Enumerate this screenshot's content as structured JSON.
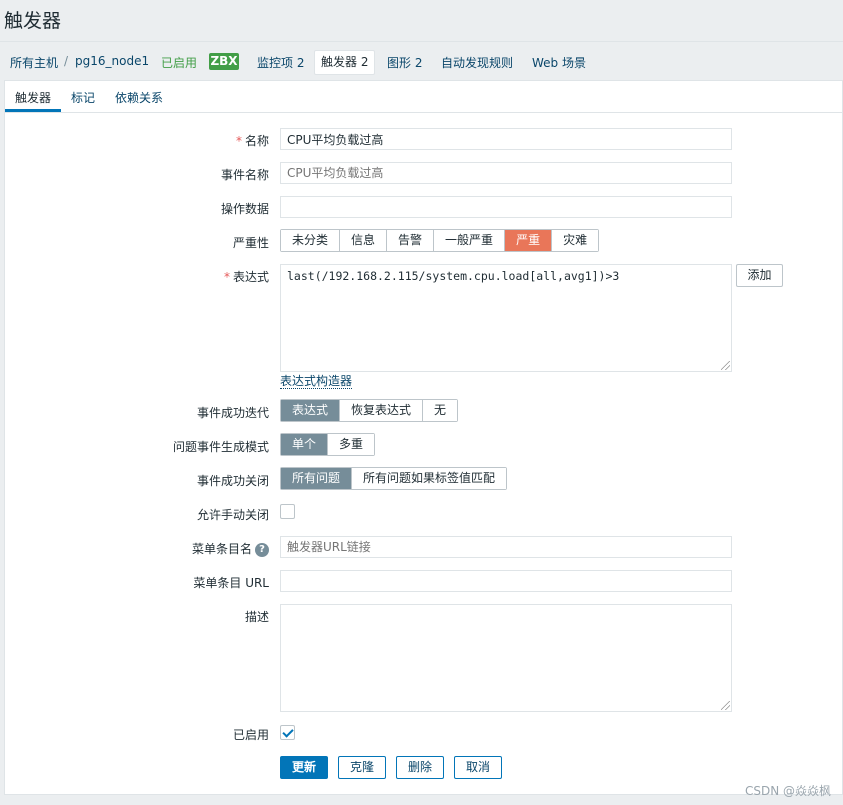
{
  "page_title": "触发器",
  "breadcrumb": {
    "all_hosts": "所有主机",
    "separator": "/",
    "host": "pg16_node1",
    "status": "已启用",
    "zbx_badge": "ZBX",
    "items": "监控项 2",
    "triggers": "触发器 2",
    "graphs": "图形 2",
    "discovery": "自动发现规则",
    "web": "Web 场景"
  },
  "tabs": [
    "触发器",
    "标记",
    "依赖关系"
  ],
  "form": {
    "name_label": "名称",
    "name_value": "CPU平均负载过高",
    "event_name_label": "事件名称",
    "event_name_placeholder": "CPU平均负载过高",
    "opdata_label": "操作数据",
    "opdata_value": "",
    "severity_label": "严重性",
    "severity_options": [
      "未分类",
      "信息",
      "告警",
      "一般严重",
      "严重",
      "灾难"
    ],
    "severity_selected": "严重",
    "expression_label": "表达式",
    "expression_value": "last(/192.168.2.115/system.cpu.load[all,avg1])>3",
    "add_button": "添加",
    "expression_builder": "表达式构造器",
    "ok_event_gen_label": "事件成功迭代",
    "ok_event_gen_options": [
      "表达式",
      "恢复表达式",
      "无"
    ],
    "ok_event_gen_selected": "表达式",
    "problem_mode_label": "问题事件生成模式",
    "problem_mode_options": [
      "单个",
      "多重"
    ],
    "problem_mode_selected": "单个",
    "ok_close_label": "事件成功关闭",
    "ok_close_options": [
      "所有问题",
      "所有问题如果标签值匹配"
    ],
    "ok_close_selected": "所有问题",
    "manual_close_label": "允许手动关闭",
    "manual_close_checked": false,
    "menu_name_label": "菜单条目名",
    "menu_name_placeholder": "触发器URL链接",
    "menu_url_label": "菜单条目 URL",
    "menu_url_value": "",
    "description_label": "描述",
    "description_value": "",
    "enabled_label": "已启用",
    "enabled_checked": true,
    "buttons": {
      "update": "更新",
      "clone": "克隆",
      "delete": "删除",
      "cancel": "取消"
    }
  },
  "watermark": "CSDN @焱焱枫",
  "colors": {
    "accent": "#0275b8",
    "severity_high": "#e97659",
    "enabled_green": "#429e47",
    "selected_gray": "#768d99"
  }
}
